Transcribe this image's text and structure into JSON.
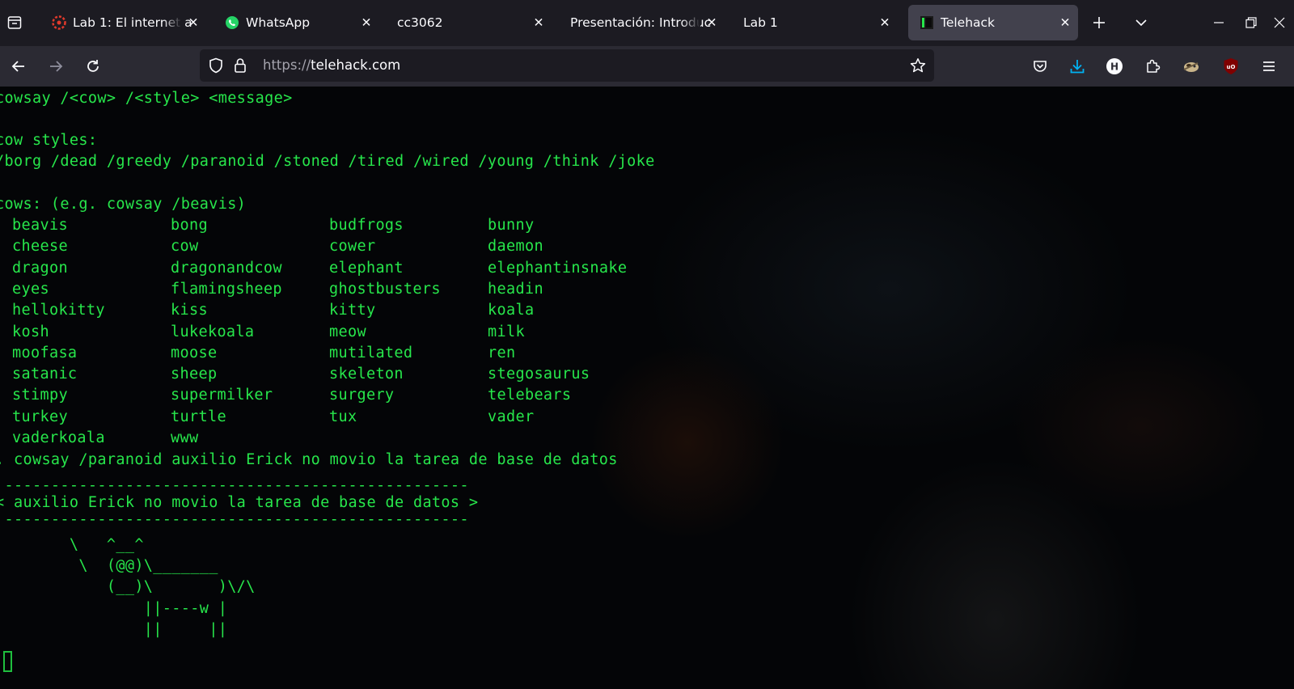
{
  "tabs": [
    {
      "title": "Lab 1: El internet a",
      "icon": "canvas-lms-icon",
      "active": false
    },
    {
      "title": "WhatsApp",
      "icon": "whatsapp-icon",
      "active": false
    },
    {
      "title": "cc3062",
      "icon": "none",
      "active": false
    },
    {
      "title": "Presentación: Introduc",
      "icon": "none",
      "active": false
    },
    {
      "title": "Lab 1",
      "icon": "none",
      "active": false
    },
    {
      "title": "Telehack",
      "icon": "telehack-icon",
      "active": true
    }
  ],
  "navbar": {
    "url_protocol": "https://",
    "url_host": "telehack.com"
  },
  "terminal": {
    "lines": [
      "cowsay /<cow> /<style> <message>",
      "",
      "cow styles:",
      "/borg /dead /greedy /paranoid /stoned /tired /wired /young /think /joke",
      "",
      "cows: (e.g. cowsay /beavis)"
    ],
    "cows": [
      [
        "beavis",
        "bong",
        "budfrogs",
        "bunny"
      ],
      [
        "cheese",
        "cow",
        "cower",
        "daemon"
      ],
      [
        "dragon",
        "dragonandcow",
        "elephant",
        "elephantinsnake"
      ],
      [
        "eyes",
        "flamingsheep",
        "ghostbusters",
        "headin"
      ],
      [
        "hellokitty",
        "kiss",
        "kitty",
        "koala"
      ],
      [
        "kosh",
        "lukekoala",
        "meow",
        "milk"
      ],
      [
        "moofasa",
        "moose",
        "mutilated",
        "ren"
      ],
      [
        "satanic",
        "sheep",
        "skeleton",
        "stegosaurus"
      ],
      [
        "stimpy",
        "supermilker",
        "surgery",
        "telebears"
      ],
      [
        "turkey",
        "turtle",
        "tux",
        "vader"
      ],
      [
        "vaderkoala",
        "www",
        "",
        ""
      ]
    ],
    "command": ". cowsay /paranoid auxilio Erick no movio la tarea de base de datos",
    "output": [
      " --------------------------------------------------",
      "< auxilio Erick no movio la tarea de base de datos >",
      " --------------------------------------------------",
      "        \\   ^__^",
      "         \\  (@@)\\_______",
      "            (__)\\       )\\/\\",
      "                ||----w |",
      "                ||     ||"
    ]
  },
  "colors": {
    "terminal_text": "#27e64b",
    "terminal_bg": "#040507",
    "tabbar_bg": "#1c1b22",
    "active_tab": "#42414d",
    "navbar_bg": "#2b2a33"
  }
}
